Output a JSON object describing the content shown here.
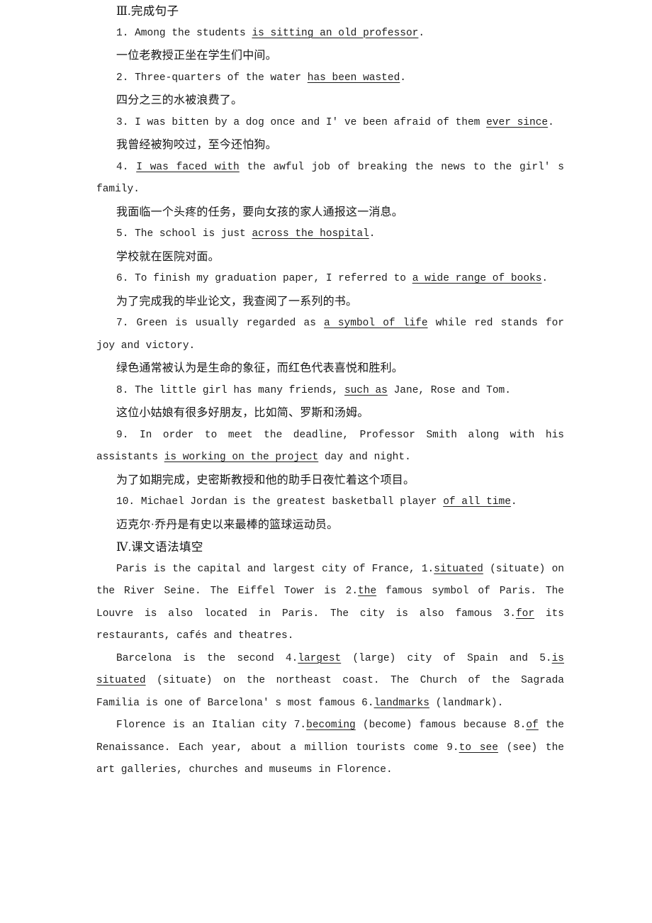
{
  "section3": {
    "heading": "Ⅲ.完成句子",
    "items": [
      {
        "number": "1.",
        "en_before": "Among the students ",
        "en_answer": "is sitting an old professor",
        "en_after": ".",
        "cn": "一位老教授正坐在学生们中间。"
      },
      {
        "number": "2.",
        "en_before": "Three-quarters of the water ",
        "en_answer": "has been wasted",
        "en_after": ".",
        "cn": "四分之三的水被浪费了。"
      },
      {
        "number": "3.",
        "en_before": "I was bitten by a dog once and I' ve been afraid of them ",
        "en_answer": "ever since",
        "en_after": ".",
        "cn": "我曾经被狗咬过，至今还怕狗。"
      },
      {
        "number": "4.",
        "en_before": "",
        "en_answer": "I was faced with",
        "en_after": " the awful job of breaking the news to the girl' s family.",
        "cn": "我面临一个头疼的任务，要向女孩的家人通报这一消息。"
      },
      {
        "number": "5.",
        "en_before": "The school is just ",
        "en_answer": "across the hospital",
        "en_after": ".",
        "cn": "学校就在医院对面。"
      },
      {
        "number": "6.",
        "en_before": "To finish my graduation paper, I referred to ",
        "en_answer": "a wide range of books",
        "en_after": ".",
        "cn": "为了完成我的毕业论文，我查阅了一系列的书。"
      },
      {
        "number": "7.",
        "en_before": "Green is usually regarded as ",
        "en_answer": "a symbol of life",
        "en_after": " while red stands for joy and victory.",
        "cn": "绿色通常被认为是生命的象征，而红色代表喜悦和胜利。"
      },
      {
        "number": "8.",
        "en_before": "The little girl has many friends, ",
        "en_answer": "such as",
        "en_after": " Jane, Rose and Tom.",
        "cn": "这位小姑娘有很多好朋友，比如简、罗斯和汤姆。"
      },
      {
        "number": "9.",
        "en_before": "In order to meet the deadline, Professor Smith along with his assistants ",
        "en_answer": "is working on the project",
        "en_after": " day and night.",
        "cn": "为了如期完成，史密斯教授和他的助手日夜忙着这个项目。"
      },
      {
        "number": "10.",
        "en_before": "Michael Jordan is the greatest basketball player ",
        "en_answer": "of all time",
        "en_after": ".",
        "cn": "迈克尔·乔丹是有史以来最棒的篮球运动员。"
      }
    ]
  },
  "section4": {
    "heading": "Ⅳ.课文语法填空",
    "paragraphs": [
      {
        "id": "paris",
        "p1": "Paris is the capital and largest city of France, 1.",
        "a1": "situated",
        "p2": " (situate) on the River Seine. The Eiffel Tower is 2.",
        "a2": "the",
        "p3": " famous symbol of Paris. The Louvre is also located in Paris. The city is also famous 3.",
        "a3": "for",
        "p4": " its restaurants, cafés and theatres."
      },
      {
        "id": "barcelona",
        "p1": "Barcelona is the second 4.",
        "a1": "largest",
        "p2": " (large) city of Spain and 5.",
        "a2": "is situated",
        "p3": " (situate) on the northeast coast. The Church of the Sagrada Familia is one of Barcelona' s most famous 6.",
        "a3": "landmarks",
        "p4": " (landmark)."
      },
      {
        "id": "florence",
        "p1": "Florence is an Italian city 7.",
        "a1": "becoming",
        "p2": " (become) famous because 8.",
        "a2": "of",
        "p3": " the Renaissance. Each year, about a million tourists come 9.",
        "a3": "to see",
        "p4": " (see) the art galleries, churches and museums in Florence."
      }
    ]
  }
}
